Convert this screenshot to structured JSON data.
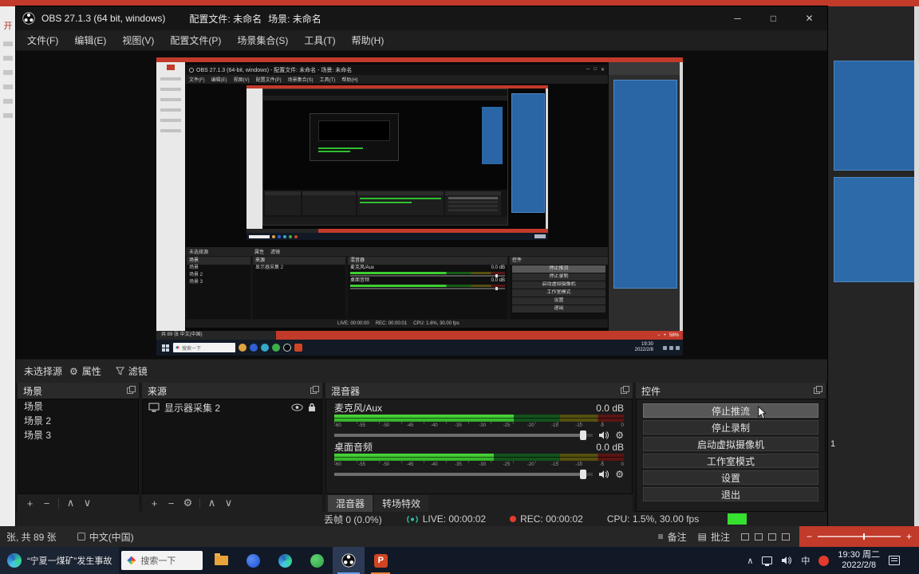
{
  "chrome": {
    "title_app": "OBS 27.1.3 (64 bit, windows)",
    "title_profile": "配置文件: 未命名",
    "title_scene": "场景: 未命名",
    "menu": [
      "文件(F)",
      "编辑(E)",
      "视图(V)",
      "配置文件(P)",
      "场景集合(S)",
      "工具(T)",
      "帮助(H)"
    ]
  },
  "icons": {
    "min": "─",
    "max": "□",
    "close": "✕",
    "plus": "+",
    "minus": "−",
    "up": "∧",
    "down": "∨",
    "gear": "⚙",
    "notes": "≡",
    "grid": "▤",
    "chevron": "∧",
    "zoom_out": "−",
    "zoom_in": "+"
  },
  "source_toolbar": {
    "status": "未选择源",
    "properties": "属性",
    "filters": "滤镜"
  },
  "scenes": {
    "title": "场景",
    "items": [
      "场景",
      "场景 2",
      "场景 3"
    ]
  },
  "sources": {
    "title": "来源",
    "item": "显示器采集 2"
  },
  "mixer": {
    "title": "混音器",
    "channels": [
      {
        "name": "麦克风/Aux",
        "db": "0.0 dB"
      },
      {
        "name": "桌面音频",
        "db": "0.0 dB"
      }
    ],
    "scale": [
      "-60",
      "-55",
      "-50",
      "-45",
      "-40",
      "-35",
      "-30",
      "-25",
      "-20",
      "-15",
      "-10",
      "-5",
      "0"
    ],
    "tab_mixer": "混音器",
    "tab_transitions": "转场特效"
  },
  "controls": {
    "title": "控件",
    "stop_stream": "停止推流",
    "stop_record": "停止录制",
    "virtual_cam": "启动虚拟摄像机",
    "studio_mode": "工作室模式",
    "settings": "设置",
    "exit": "退出"
  },
  "statusbar": {
    "dropped": "丢帧 0 (0.0%)",
    "live": "LIVE: 00:00:02",
    "rec": "REC: 00:00:02",
    "cpu": "CPU: 1.5%, 30.00 fps"
  },
  "preview": {
    "title": "OBS 27.1.3 (64-bit, windows) - 配置文件: 未命名 - 场景: 未命名",
    "status_live": "LIVE: 00:00:00",
    "status_rec": "REC: 00:00:01",
    "status_cpu": "CPU: 1.6%, 30.00 fps",
    "ppt_info": "共 89 张  中文(中国)",
    "zoom": "58%",
    "clock_time": "19:30",
    "clock_date": "2022/2/8"
  },
  "ppt_bar": {
    "slide_info": "张, 共 89 张",
    "language": "中文(中国)",
    "notes": "备注",
    "comments": "批注"
  },
  "taskbar": {
    "news": "“宁夏一煤矿”发生事故",
    "search": "搜索一下",
    "ime": "中",
    "clock_time": "19:30 周二",
    "clock_date": "2022/2/8"
  },
  "background": {
    "left_char": "开",
    "slide_number": "1"
  }
}
